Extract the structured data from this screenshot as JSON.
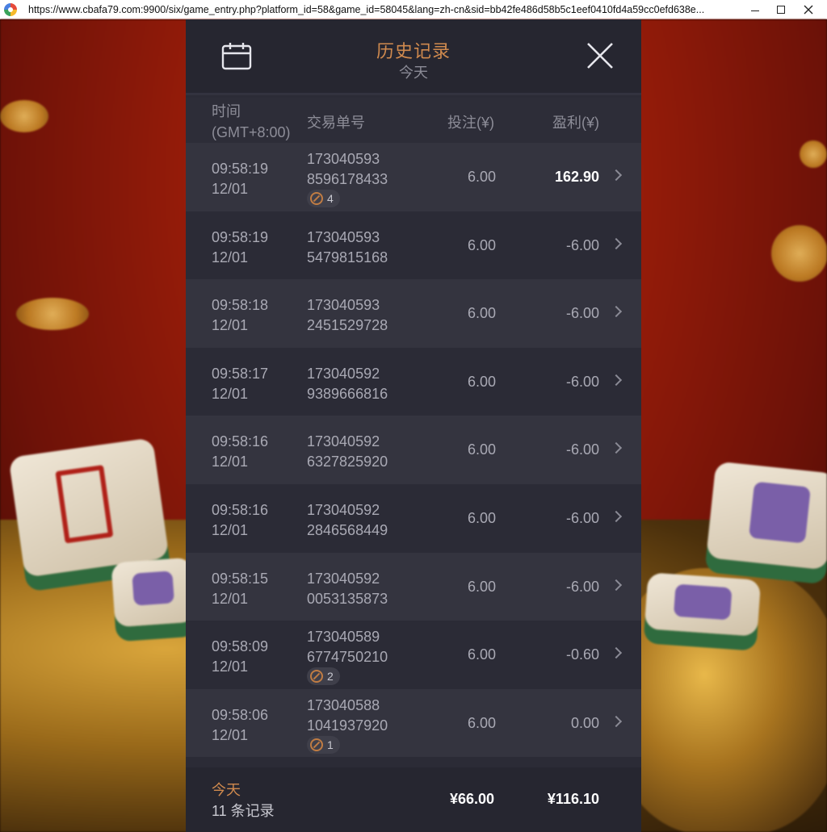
{
  "window": {
    "url": "https://www.cbafa79.com:9900/six/game_entry.php?platform_id=58&game_id=58045&lang=zh-cn&sid=bb42fe486d58b5c1eef0410fd4a59cc0efd638e..."
  },
  "header": {
    "title": "历史记录",
    "subtitle": "今天"
  },
  "columns": {
    "time_line1": "时间",
    "time_line2": "(GMT+8:00)",
    "txid": "交易单号",
    "bet": "投注(¥)",
    "profit": "盈利(¥)"
  },
  "rows": [
    {
      "time": "09:58:19",
      "date": "12/01",
      "tx1": "173040593",
      "tx2": "8596178433",
      "badge": "4",
      "bet": "6.00",
      "profit": "162.90",
      "positive": true
    },
    {
      "time": "09:58:19",
      "date": "12/01",
      "tx1": "173040593",
      "tx2": "5479815168",
      "badge": null,
      "bet": "6.00",
      "profit": "-6.00",
      "positive": false
    },
    {
      "time": "09:58:18",
      "date": "12/01",
      "tx1": "173040593",
      "tx2": "2451529728",
      "badge": null,
      "bet": "6.00",
      "profit": "-6.00",
      "positive": false
    },
    {
      "time": "09:58:17",
      "date": "12/01",
      "tx1": "173040592",
      "tx2": "9389666816",
      "badge": null,
      "bet": "6.00",
      "profit": "-6.00",
      "positive": false
    },
    {
      "time": "09:58:16",
      "date": "12/01",
      "tx1": "173040592",
      "tx2": "6327825920",
      "badge": null,
      "bet": "6.00",
      "profit": "-6.00",
      "positive": false
    },
    {
      "time": "09:58:16",
      "date": "12/01",
      "tx1": "173040592",
      "tx2": "2846568449",
      "badge": null,
      "bet": "6.00",
      "profit": "-6.00",
      "positive": false
    },
    {
      "time": "09:58:15",
      "date": "12/01",
      "tx1": "173040592",
      "tx2": "0053135873",
      "badge": null,
      "bet": "6.00",
      "profit": "-6.00",
      "positive": false
    },
    {
      "time": "09:58:09",
      "date": "12/01",
      "tx1": "173040589",
      "tx2": "6774750210",
      "badge": "2",
      "bet": "6.00",
      "profit": "-0.60",
      "positive": false
    },
    {
      "time": "09:58:06",
      "date": "12/01",
      "tx1": "173040588",
      "tx2": "1041937920",
      "badge": "1",
      "bet": "6.00",
      "profit": "0.00",
      "positive": false
    }
  ],
  "footer": {
    "label": "今天",
    "count": "11 条记录",
    "total_bet": "¥66.00",
    "total_profit": "¥116.10"
  },
  "icons": {
    "calendar": "calendar-icon",
    "close": "close-icon",
    "chevron": "chevron-right-icon",
    "badge": "link-icon"
  },
  "colors": {
    "accent": "#d08a4e",
    "modal_bg": "#2b2b36",
    "row_alt": "#34343f"
  }
}
